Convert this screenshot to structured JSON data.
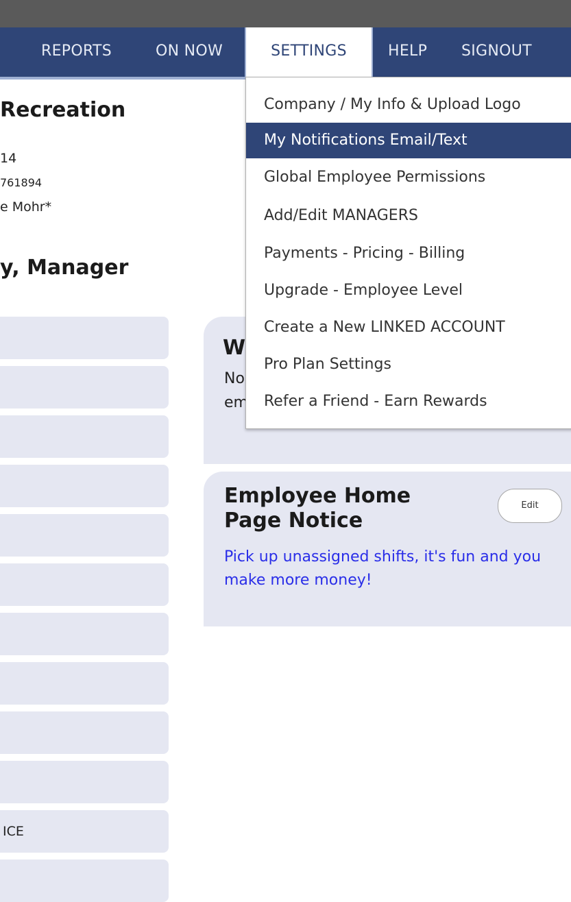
{
  "nav": {
    "items": [
      "REPORTS",
      "ON NOW",
      "SETTINGS",
      "HELP",
      "SIGNOUT"
    ],
    "active": "SETTINGS"
  },
  "company": {
    "name": "Recreation",
    "info_line_1": "14",
    "info_line_2": "761894",
    "info_line_3": "e Mohr*"
  },
  "manager_title": "y, Manager",
  "sidebar": {
    "items": [
      "",
      "",
      "",
      "",
      "",
      "",
      "",
      "",
      "",
      "",
      "",
      "ICE",
      ""
    ]
  },
  "welcome_panel": {
    "title_partial": "W",
    "line1_partial": "No",
    "line2_partial": "em"
  },
  "notice_panel": {
    "title": "Employee Home Page Notice",
    "edit_label": "Edit",
    "text": "Pick up unassigned shifts, it's fun and you make more money!"
  },
  "settings_menu": {
    "items": [
      "Company / My Info & Upload Logo",
      "My Notifications Email/Text",
      "Global Employee Permissions",
      "Add/Edit MANAGERS",
      "Payments - Pricing - Billing",
      "Upgrade - Employee Level",
      "Create a New LINKED ACCOUNT",
      "Pro Plan Settings",
      "Refer a Friend - Earn Rewards"
    ],
    "highlighted": "My Notifications Email/Text"
  },
  "colors": {
    "nav_bg": "#2f4577",
    "top_bar": "#5a5a5a",
    "panel_bg": "#e5e7f2",
    "notice_text": "#2a2ee8"
  }
}
